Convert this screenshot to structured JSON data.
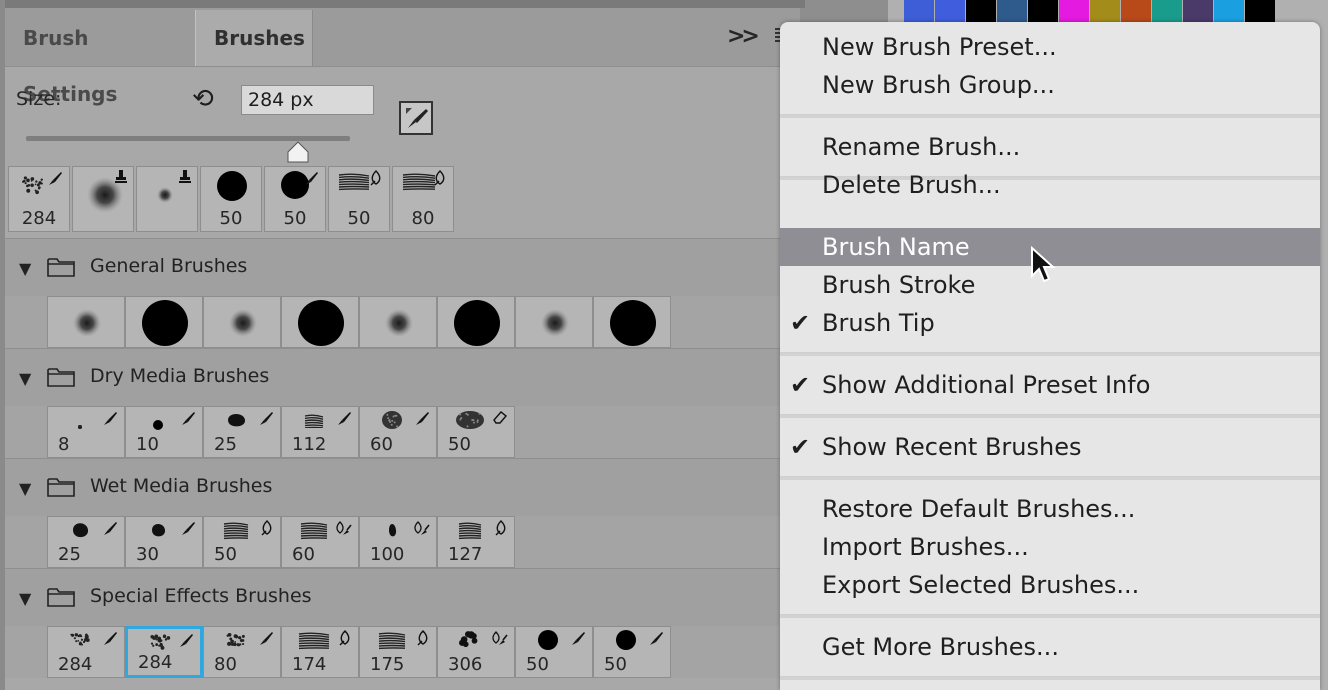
{
  "tabs": [
    {
      "label": "Brush Settings"
    },
    {
      "label": "Brushes"
    }
  ],
  "size": {
    "label": "Size:",
    "value": "284 px",
    "slider_fraction": 0.84
  },
  "icons": {
    "collapse": "double-chevron-right-icon",
    "menu": "hamburger-menu-icon",
    "reset": "reset-size-icon",
    "new_brush": "new-brush-icon",
    "folder": "folder-icon",
    "chevron": "chevron-down-icon"
  },
  "recent": [
    {
      "size": "284"
    },
    {
      "size": ""
    },
    {
      "size": ""
    },
    {
      "size": "50"
    },
    {
      "size": "50"
    },
    {
      "size": "50"
    },
    {
      "size": "80"
    }
  ],
  "groups": [
    {
      "title": "General Brushes",
      "brushes": [
        {
          "size": ""
        },
        {
          "size": ""
        },
        {
          "size": ""
        },
        {
          "size": ""
        },
        {
          "size": ""
        },
        {
          "size": ""
        },
        {
          "size": ""
        },
        {
          "size": ""
        }
      ]
    },
    {
      "title": "Dry Media Brushes",
      "brushes": [
        {
          "size": "8"
        },
        {
          "size": "10"
        },
        {
          "size": "25"
        },
        {
          "size": "112"
        },
        {
          "size": "60"
        },
        {
          "size": "50"
        }
      ]
    },
    {
      "title": "Wet Media Brushes",
      "brushes": [
        {
          "size": "25"
        },
        {
          "size": "30"
        },
        {
          "size": "50"
        },
        {
          "size": "60"
        },
        {
          "size": "100"
        },
        {
          "size": "127"
        }
      ]
    },
    {
      "title": "Special Effects Brushes",
      "brushes": [
        {
          "size": "284"
        },
        {
          "size": "284"
        },
        {
          "size": "80"
        },
        {
          "size": "174"
        },
        {
          "size": "175"
        },
        {
          "size": "306"
        },
        {
          "size": "50"
        },
        {
          "size": "50"
        }
      ]
    }
  ],
  "menu": {
    "items": [
      {
        "label": "New Brush Preset...",
        "checked": false
      },
      {
        "label": "New Brush Group...",
        "checked": false
      },
      {
        "label": "Rename Brush...",
        "checked": false
      },
      {
        "label": "Delete Brush...",
        "checked": false
      },
      {
        "label": "Brush Name",
        "checked": false,
        "highlighted": true
      },
      {
        "label": "Brush Stroke",
        "checked": false
      },
      {
        "label": "Brush Tip",
        "checked": true
      },
      {
        "label": "Show Additional Preset Info",
        "checked": true
      },
      {
        "label": "Show Recent Brushes",
        "checked": true
      },
      {
        "label": "Restore Default Brushes...",
        "checked": false
      },
      {
        "label": "Import Brushes...",
        "checked": false
      },
      {
        "label": "Export Selected Brushes...",
        "checked": false
      },
      {
        "label": "Get More Brushes...",
        "checked": false
      }
    ],
    "check_glyph": "✔"
  },
  "swatch_colors": [
    "#3d5ed6",
    "#3f5ddc",
    "#000000",
    "#2f5a8c",
    "#000000",
    "#e51ae0",
    "#a38c1a",
    "#b84a1a",
    "#1a9c8c",
    "#4a3a6a",
    "#1aa0e0",
    "#000000"
  ],
  "colors": {
    "selection": "#2fa8e0",
    "highlight": "#8e8e94"
  }
}
